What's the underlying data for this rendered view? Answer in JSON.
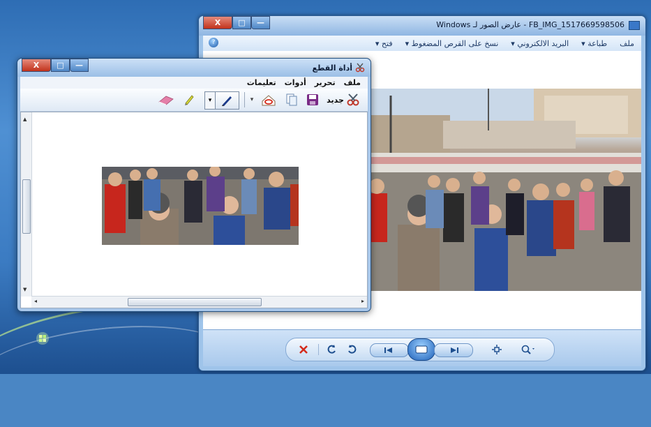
{
  "viewer": {
    "title": "FB_IMG_1517669598506 - عارض الصور لـ Windows",
    "menu": [
      "ملف",
      "طباعة",
      "البريد الالكتروني",
      "نسخ على القرص المضغوط",
      "فتح"
    ],
    "buttons": {
      "close": "X",
      "maximize": "□",
      "minimize": "—"
    }
  },
  "snipping_tool": {
    "title": "أداة القطع",
    "menu": [
      "ملف",
      "تحرير",
      "أدوات",
      "تعليمات"
    ],
    "new_label": "جديد",
    "buttons": {
      "close": "X",
      "maximize": "□",
      "minimize": "—"
    }
  },
  "icons": {
    "viewer_controls": [
      "zoom-icon",
      "fit-icon",
      "previous-icon",
      "slideshow-icon",
      "next-icon",
      "rotate-left-icon",
      "rotate-right-icon",
      "delete-icon"
    ],
    "snip_tools": [
      "scissors-icon",
      "save-icon",
      "copy-icon",
      "send-icon",
      "pen-icon",
      "highlighter-icon",
      "eraser-icon"
    ]
  },
  "colors": {
    "delete": "#d42a1a",
    "accent": "#3a78c8"
  }
}
